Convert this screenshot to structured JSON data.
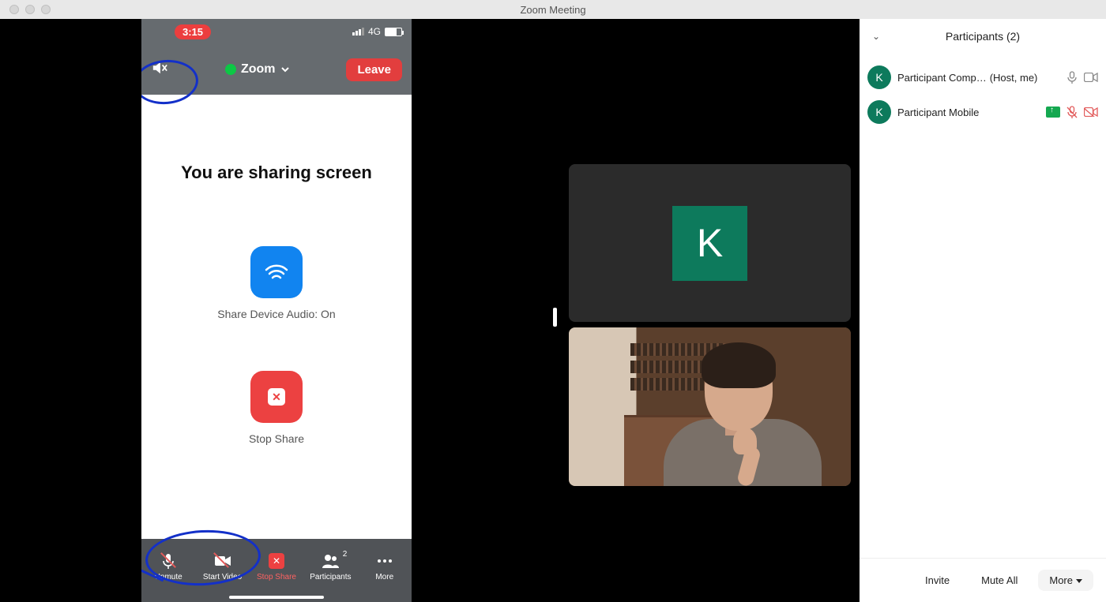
{
  "window": {
    "title": "Zoom Meeting"
  },
  "phone": {
    "status": {
      "time": "3:15",
      "network": "4G"
    },
    "header": {
      "speaker_icon": "speaker-muted",
      "app": "Zoom",
      "leave": "Leave"
    },
    "body": {
      "headline": "You are sharing screen",
      "audio_btn_label": "Share Device Audio: On",
      "stop_btn_label": "Stop Share"
    },
    "toolbar": {
      "unmute": "Unmute",
      "start_video": "Start Video",
      "stop_share": "Stop Share",
      "participants": "Participants",
      "participants_count": "2",
      "more": "More"
    }
  },
  "tiles": {
    "avatar_initial_remote": "K"
  },
  "panel": {
    "title": "Participants (2)",
    "rows": [
      {
        "initial": "K",
        "name": "Participant Comp…",
        "role": "(Host, me)"
      },
      {
        "initial": "K",
        "name": "Participant Mobile",
        "role": ""
      }
    ],
    "footer": {
      "invite": "Invite",
      "mute_all": "Mute All",
      "more": "More"
    }
  }
}
